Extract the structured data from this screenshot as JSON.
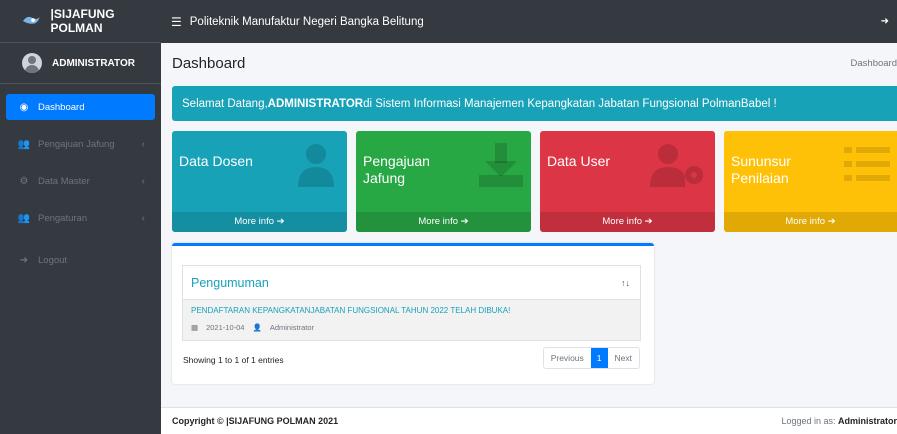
{
  "brand": {
    "name": "|SIJAFUNG POLMAN"
  },
  "user": {
    "name": "ADMINISTRATOR"
  },
  "sidebar": {
    "items": [
      {
        "label": "Dashboard",
        "icon": "tachometer-icon"
      },
      {
        "label": "Pengajuan Jafung",
        "icon": "users-icon"
      },
      {
        "label": "Data Master",
        "icon": "cogs-icon"
      },
      {
        "label": "Pengaturan",
        "icon": "users-icon"
      },
      {
        "label": "Logout",
        "icon": "sign-out-icon"
      }
    ]
  },
  "topbar": {
    "title": "Politeknik Manufaktur Negeri Bangka Belitung"
  },
  "page": {
    "title": "Dashboard",
    "breadcrumb": "Dashboard"
  },
  "alert": {
    "prefix": "Selamat Datang, ",
    "name": "ADMINISTRATOR",
    "suffix": " di Sistem Informasi Manajemen Kepangkatan Jabatan Fungsional PolmanBabel !"
  },
  "boxes": [
    {
      "title": "Data Dosen",
      "footer": "More info",
      "color": "#17a2b8",
      "icon": "user-icon"
    },
    {
      "title": "Pengajuan Jafung",
      "footer": "More info",
      "color": "#28a745",
      "icon": "download-icon"
    },
    {
      "title": "Data User",
      "footer": "More info",
      "color": "#dc3545",
      "icon": "user-cog-icon"
    },
    {
      "title": "Sununsur Penilaian",
      "footer": "More info",
      "color": "#ffc107",
      "icon": "list-icon"
    }
  ],
  "announcements": {
    "header": "Pengumuman",
    "rows": [
      {
        "title": "PENDAFTARAN KEPANGKATANJABATAN FUNGSIONAL TAHUN 2022 TELAH DIBUKA!",
        "date": "2021-10-04",
        "author": "Administrator"
      }
    ],
    "showing": "Showing 1 to 1 of 1 entries",
    "pager": {
      "prev": "Previous",
      "current": "1",
      "next": "Next"
    }
  },
  "footer": {
    "copyright": "Copyright © |SIJAFUNG POLMAN 2021",
    "logged_prefix": "Logged in as: ",
    "logged_user": "Administrator"
  }
}
